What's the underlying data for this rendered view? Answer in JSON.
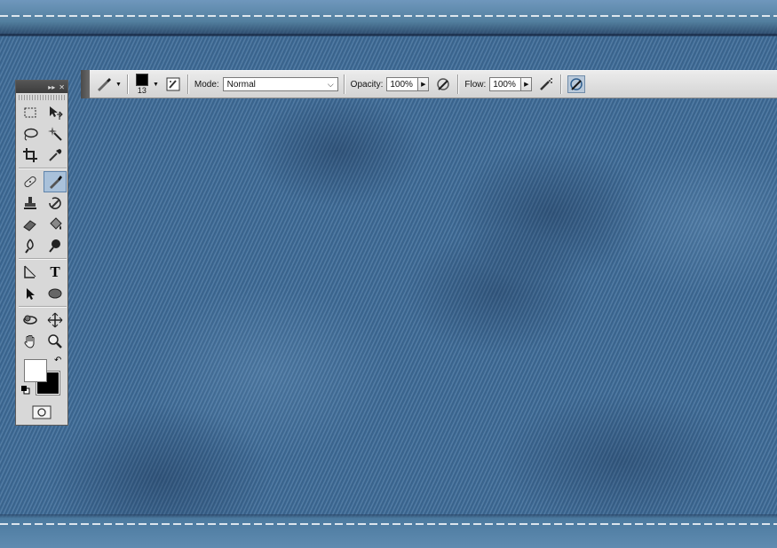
{
  "options_bar": {
    "brush_size": "13",
    "mode_label": "Mode:",
    "mode_value": "Normal",
    "opacity_label": "Opacity:",
    "opacity_value": "100%",
    "flow_label": "Flow:",
    "flow_value": "100%"
  },
  "tools_panel": {
    "header_controls": [
      "▸▸",
      "✕"
    ],
    "tools": [
      {
        "name": "rectangular-marquee",
        "icon": "marquee-icon"
      },
      {
        "name": "move",
        "icon": "move-icon"
      },
      {
        "name": "lasso",
        "icon": "lasso-icon"
      },
      {
        "name": "magic-wand",
        "icon": "magic-wand-icon"
      },
      {
        "name": "crop",
        "icon": "crop-icon"
      },
      {
        "name": "eyedropper",
        "icon": "eyedropper-icon"
      },
      {
        "name": "healing-brush",
        "icon": "bandage-icon"
      },
      {
        "name": "brush",
        "icon": "brush-icon",
        "active": true
      },
      {
        "name": "clone-stamp",
        "icon": "stamp-icon"
      },
      {
        "name": "history-brush",
        "icon": "history-brush-icon"
      },
      {
        "name": "eraser",
        "icon": "eraser-icon"
      },
      {
        "name": "paint-bucket",
        "icon": "bucket-icon"
      },
      {
        "name": "blur",
        "icon": "blur-icon"
      },
      {
        "name": "dodge",
        "icon": "dodge-icon"
      },
      {
        "name": "pen",
        "icon": "pen-icon"
      },
      {
        "name": "type",
        "icon": "type-icon",
        "glyph": "T"
      },
      {
        "name": "path-selection",
        "icon": "arrow-icon"
      },
      {
        "name": "ellipse",
        "icon": "ellipse-icon"
      },
      {
        "name": "3d-rotate",
        "icon": "3d-rotate-icon"
      },
      {
        "name": "3d-pan",
        "icon": "3d-pan-icon"
      },
      {
        "name": "hand",
        "icon": "hand-icon"
      },
      {
        "name": "zoom",
        "icon": "zoom-icon"
      }
    ],
    "foreground_color": "#ffffff",
    "background_color": "#000000"
  },
  "colors": {
    "denim": "#3f6d9a",
    "stitch": "#ebf0f5",
    "panel": "#d8d8d8"
  }
}
